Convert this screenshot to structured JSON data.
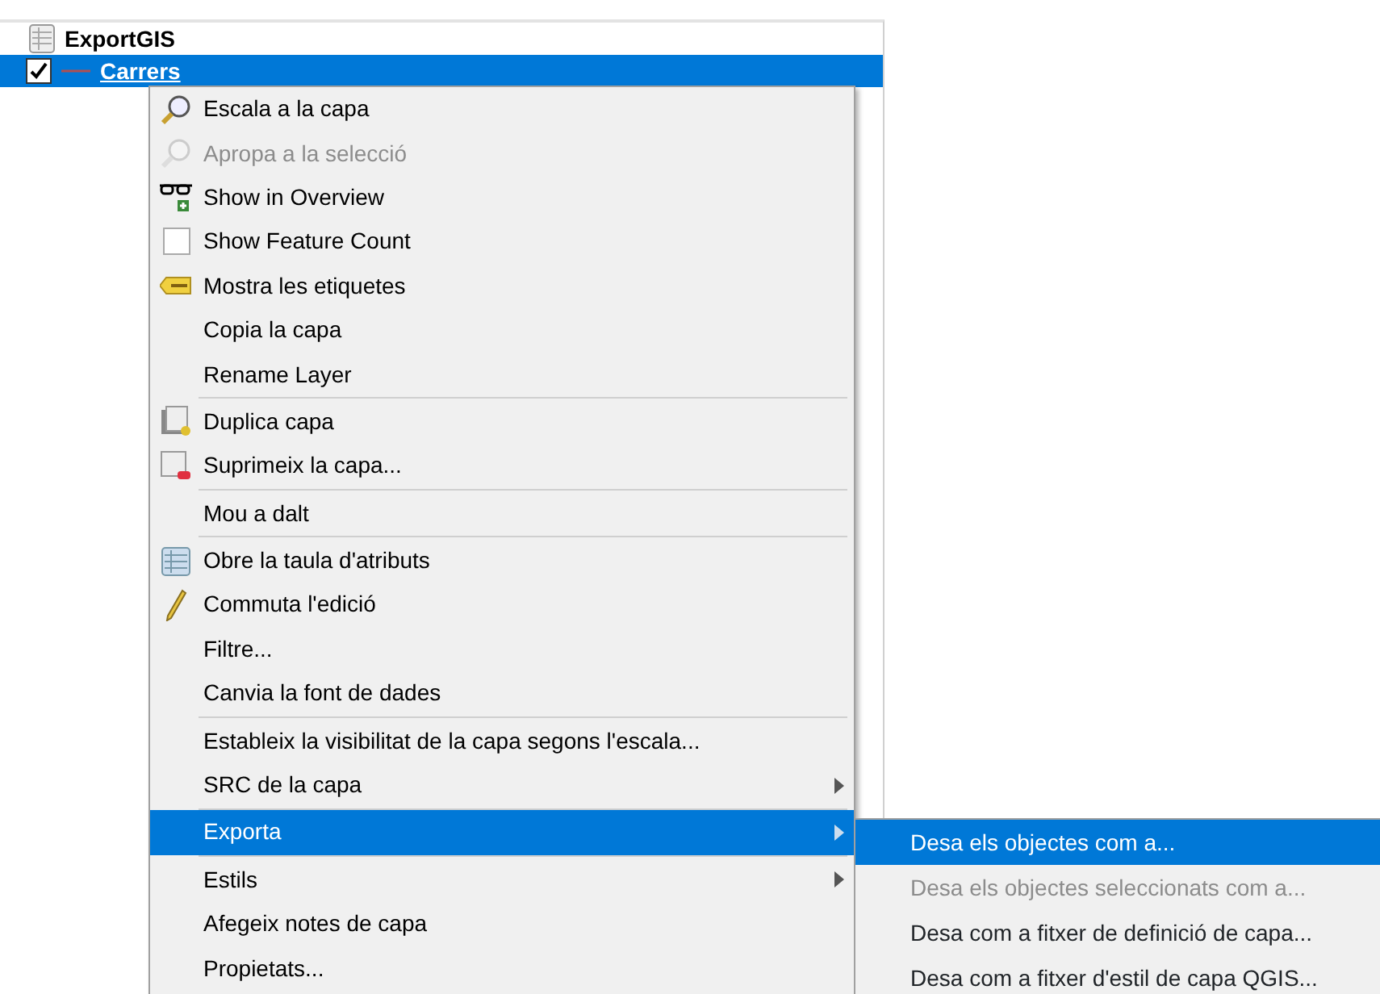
{
  "layers_panel": {
    "groups": [
      {
        "name": "ExportGIS",
        "layers": [
          {
            "name": "Carrers",
            "visible": true,
            "selected": true
          }
        ]
      }
    ]
  },
  "context_menu": {
    "items": [
      {
        "kind": "item",
        "label": "Escala a la capa",
        "disabled": false,
        "selected": false
      },
      {
        "kind": "item",
        "label": "Apropa a la selecció",
        "disabled": true,
        "selected": false
      },
      {
        "kind": "item",
        "label": "Show in Overview",
        "disabled": false,
        "selected": false
      },
      {
        "kind": "check",
        "label": "Show Feature Count",
        "checked": false,
        "disabled": false,
        "selected": false
      },
      {
        "kind": "item",
        "label": "Mostra les etiquetes",
        "disabled": false,
        "selected": false
      },
      {
        "kind": "item",
        "label": "Copia la capa",
        "disabled": false,
        "selected": false
      },
      {
        "kind": "item",
        "label": "Rename Layer",
        "disabled": false,
        "selected": false
      },
      {
        "kind": "separator"
      },
      {
        "kind": "item",
        "label": "Duplica capa",
        "disabled": false,
        "selected": false
      },
      {
        "kind": "item",
        "label": "Suprimeix la capa...",
        "disabled": false,
        "selected": false
      },
      {
        "kind": "separator"
      },
      {
        "kind": "item",
        "label": "Mou a dalt",
        "disabled": false,
        "selected": false
      },
      {
        "kind": "separator"
      },
      {
        "kind": "item",
        "label": "Obre la taula d'atributs",
        "disabled": false,
        "selected": false
      },
      {
        "kind": "item",
        "label": "Commuta l'edició",
        "disabled": false,
        "selected": false
      },
      {
        "kind": "item",
        "label": "Filtre...",
        "disabled": false,
        "selected": false
      },
      {
        "kind": "item",
        "label": "Canvia la font de dades",
        "disabled": false,
        "selected": false
      },
      {
        "kind": "separator"
      },
      {
        "kind": "item",
        "label": "Estableix la visibilitat de la capa segons l'escala...",
        "disabled": false,
        "selected": false
      },
      {
        "kind": "submenu",
        "label": "SRC de la capa",
        "disabled": false,
        "selected": false
      },
      {
        "kind": "separator"
      },
      {
        "kind": "submenu",
        "label": "Exporta",
        "disabled": false,
        "selected": true
      },
      {
        "kind": "separator"
      },
      {
        "kind": "submenu",
        "label": "Estils",
        "disabled": false,
        "selected": false
      },
      {
        "kind": "item",
        "label": "Afegeix notes de capa",
        "disabled": false,
        "selected": false
      },
      {
        "kind": "item",
        "label": "Propietats...",
        "disabled": false,
        "selected": false
      }
    ]
  },
  "submenu": {
    "items": [
      {
        "label": "Desa els objectes com a...",
        "disabled": false,
        "selected": true
      },
      {
        "label": "Desa els objectes seleccionats com a...",
        "disabled": true,
        "selected": false
      },
      {
        "label": "Desa com a fitxer de definició de capa...",
        "disabled": false,
        "selected": false
      },
      {
        "label": "Desa com a fitxer d'estil de capa QGIS...",
        "disabled": false,
        "selected": false
      }
    ]
  }
}
